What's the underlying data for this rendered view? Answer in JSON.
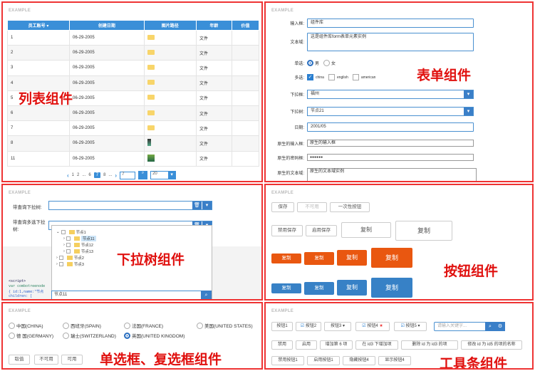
{
  "example_label": "EXAMPLE",
  "list": {
    "caption": "列表组件",
    "columns": [
      "员工账号 ▾",
      "创建日期",
      "图片路径",
      "年龄",
      "价值"
    ],
    "rows": [
      {
        "id": "1",
        "date": "06-29-2005",
        "img": "folder",
        "age": "文件"
      },
      {
        "id": "2",
        "date": "06-29-2005",
        "img": "folder",
        "age": "文件"
      },
      {
        "id": "3",
        "date": "06-29-2005",
        "img": "folder",
        "age": "文件"
      },
      {
        "id": "4",
        "date": "06-29-2005",
        "img": "folder",
        "age": "文件"
      },
      {
        "id": "5",
        "date": "06-29-2005",
        "img": "folder",
        "age": "文件"
      },
      {
        "id": "6",
        "date": "06-29-2005",
        "img": "folder",
        "age": "文件"
      },
      {
        "id": "7",
        "date": "06-29-2005",
        "img": "folder",
        "age": "文件"
      },
      {
        "id": "8",
        "date": "06-29-2005",
        "img": "photo-small",
        "age": "文件"
      },
      {
        "id": "11",
        "date": "06-29-2005",
        "img": "photo-green",
        "age": "文件"
      }
    ],
    "pager": {
      "prev": "‹",
      "p1": "1",
      "p2": "2",
      "dots1": "...",
      "p6": "6",
      "p7": "7",
      "p8": "8",
      "dots2": "...",
      "next": "›",
      "goto_value": "7",
      "size_value": "20"
    }
  },
  "form": {
    "caption": "表单组件",
    "input_label": "输入框:",
    "input_value": "组件库",
    "textarea_label": "文本域:",
    "textarea_value": "这是组件库form表单元素实例",
    "radio_label": "单选:",
    "radio_male": "男",
    "radio_female": "女",
    "check_label": "多选:",
    "check_china": "china",
    "check_english": "english",
    "check_american": "american",
    "select1_label": "下拉框:",
    "select1_value": "福州",
    "select2_label": "下拉树:",
    "select2_value": "节点21",
    "date_label": "日期:",
    "date_value": "2001/05",
    "native_input_label": "原生的输入框:",
    "native_input_value": "原生的输入框",
    "native_pwd_label": "原生的密码框:",
    "native_pwd_value": "●●●●●●",
    "native_text_label": "原生的文本域:",
    "native_text_value": "原生的文本域实例"
  },
  "tree": {
    "caption": "下拉树组件",
    "label1": "带查询下拉树:",
    "label2": "带查询多选下拉树:",
    "nodes": [
      "节点1",
      "节点11",
      "节点12",
      "节点13",
      "节点2",
      "节点3"
    ],
    "code1": "<script>",
    "code2": "var combotreenode",
    "code3": "{ id:1,name:\"节点",
    "code4": "children: [",
    "search_value": "节点11"
  },
  "buttons": {
    "caption": "按钮组件",
    "save": "保存",
    "disabled": "不可用",
    "once": "一次性按钮",
    "disable_save": "禁用保存",
    "enable_save": "启用保存",
    "copy": "复制"
  },
  "radios": {
    "caption": "单选框、复选框组件",
    "opts": [
      "中国(CHINA)",
      "西班牙(SPAIN)",
      "法国(FRANCE)",
      "美国(UNITED STATES)",
      "德 国(GERMANY)",
      "瑞士(SWITZERLAND)",
      "英国(UNITED KINGDOM)"
    ],
    "b1": "取值",
    "b2": "不可用",
    "b3": "可用"
  },
  "toolbar": {
    "caption": "工具条组件",
    "r1": [
      "按钮1",
      "按钮2",
      "按钮3",
      "按钮4",
      "按钮5"
    ],
    "search_placeholder": "请输入关键字...",
    "r2": [
      "禁用",
      "启用",
      "增加第 6 项",
      "在 id3 下增加项",
      "删除 id 为 id3 的项",
      "修改 id 为 id5 的项的名称"
    ],
    "r3": [
      "禁用按钮1",
      "启用按钮1",
      "隐藏按钮4",
      "显示按钮4"
    ]
  },
  "colors": {
    "accent": "#3a8fd8",
    "frame": "#ee3333",
    "orange": "#e95710",
    "caption": "#e0100e"
  }
}
